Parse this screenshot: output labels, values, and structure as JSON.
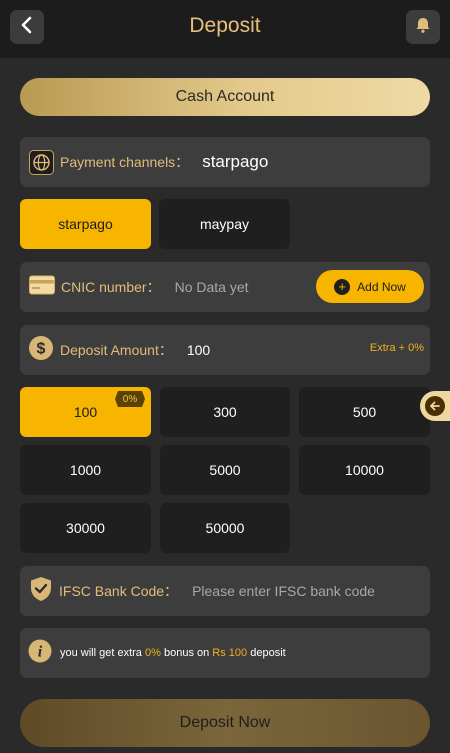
{
  "header": {
    "title": "Deposit",
    "back_icon": "chevron-left-icon",
    "bell_icon": "bell-icon"
  },
  "cash_account": {
    "label": "Cash Account"
  },
  "payment_channels": {
    "label": "Payment channels：",
    "value": "starpago",
    "options": [
      {
        "label": "starpago",
        "selected": true
      },
      {
        "label": "maypay",
        "selected": false
      }
    ]
  },
  "cnic": {
    "label": "CNIC number：",
    "value": "No Data yet",
    "add_button": "Add Now"
  },
  "deposit_amount": {
    "label": "Deposit Amount：",
    "value": "100",
    "extra": "Extra + 0%",
    "badge": "0%",
    "amounts": [
      {
        "label": "100",
        "selected": true
      },
      {
        "label": "300",
        "selected": false
      },
      {
        "label": "500",
        "selected": false
      },
      {
        "label": "1000",
        "selected": false
      },
      {
        "label": "5000",
        "selected": false
      },
      {
        "label": "10000",
        "selected": false
      },
      {
        "label": "30000",
        "selected": false
      },
      {
        "label": "50000",
        "selected": false
      }
    ]
  },
  "ifsc": {
    "label": "IFSC Bank Code：",
    "placeholder": "Please enter IFSC bank code"
  },
  "info": {
    "prefix": "you will get extra",
    "percent": "0%",
    "middle": "bonus on",
    "amount": "Rs 100",
    "suffix": "deposit"
  },
  "submit": {
    "label": "Deposit Now"
  },
  "colors": {
    "accent": "#f7b500",
    "gold_text": "#e2bd7a",
    "page_bg": "#2a2a2a",
    "card_bg": "#3d3d3d"
  }
}
